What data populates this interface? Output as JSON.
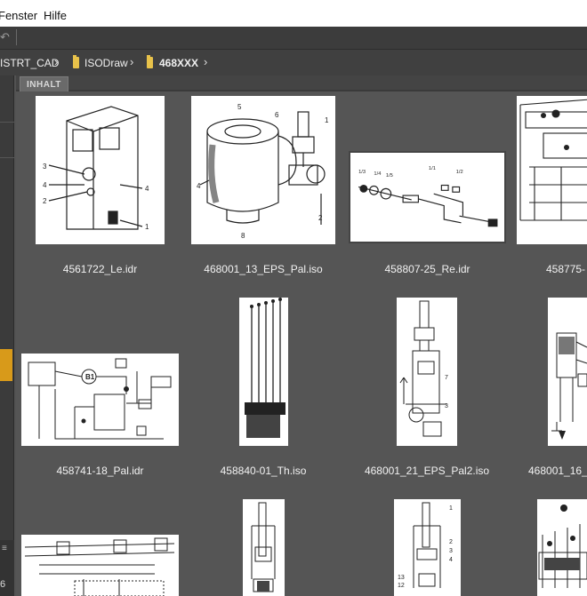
{
  "menu": {
    "fenster": "Fenster",
    "hilfe": "Hilfe"
  },
  "breadcrumb": {
    "root": "ISTRT_CAD",
    "folder1": "ISODraw",
    "folder2": "468XXX"
  },
  "tab": {
    "label": "INHALT"
  },
  "left_panel": {
    "number": "6"
  },
  "files": [
    {
      "name": "4561722_Le.idr"
    },
    {
      "name": "468001_13_EPS_Pal.iso"
    },
    {
      "name": "458807-25_Re.idr"
    },
    {
      "name": "458775-"
    },
    {
      "name": "458741-18_Pal.idr"
    },
    {
      "name": "458840-01_Th.iso"
    },
    {
      "name": "468001_21_EPS_Pal2.iso"
    },
    {
      "name": "468001_16_"
    }
  ],
  "colors": {
    "accent": "#d89a1a",
    "folder": "#e8c24a",
    "background": "#535353"
  }
}
